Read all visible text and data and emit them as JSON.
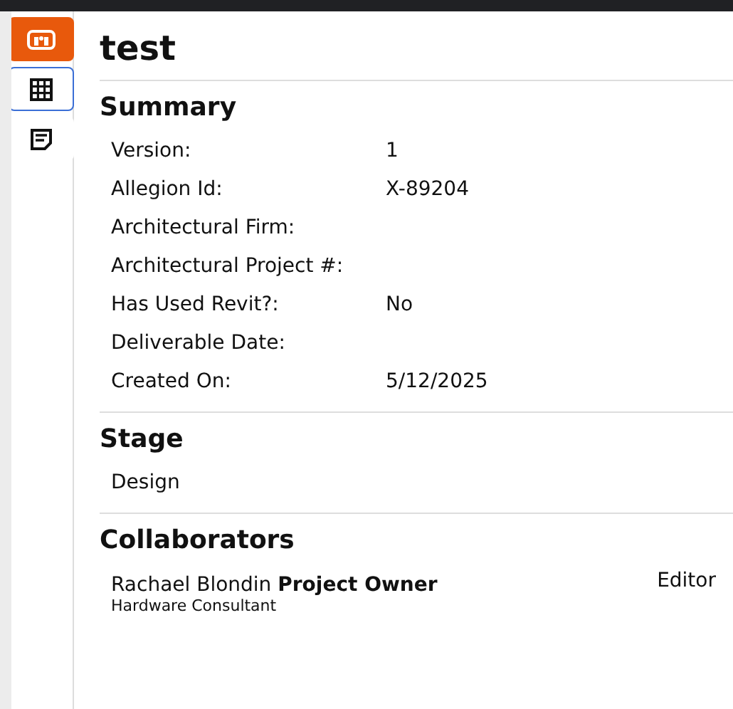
{
  "sidebar": {
    "items": [
      {
        "kind": "app",
        "selected": false
      },
      {
        "kind": "grid",
        "selected": true
      },
      {
        "kind": "notes",
        "selected": false
      }
    ]
  },
  "title": "test",
  "summary": {
    "heading": "Summary",
    "fields": [
      {
        "label": "Version:",
        "value": "1"
      },
      {
        "label": "Allegion Id:",
        "value": "X-89204"
      },
      {
        "label": "Architectural Firm:"
      },
      {
        "label": "Architectural Project #:"
      },
      {
        "label": "Has Used Revit?:",
        "value": "No"
      },
      {
        "label": "Deliverable Date:"
      },
      {
        "label": "Created On:",
        "value": "5/12/2025"
      }
    ]
  },
  "stage": {
    "heading": "Stage",
    "value": "Design"
  },
  "collaborators": {
    "heading": "Collaborators",
    "people": [
      {
        "name": "Rachael Blondin **Project Owner**",
        "title": "Hardware Consultant",
        "access": "Editor"
      }
    ]
  }
}
